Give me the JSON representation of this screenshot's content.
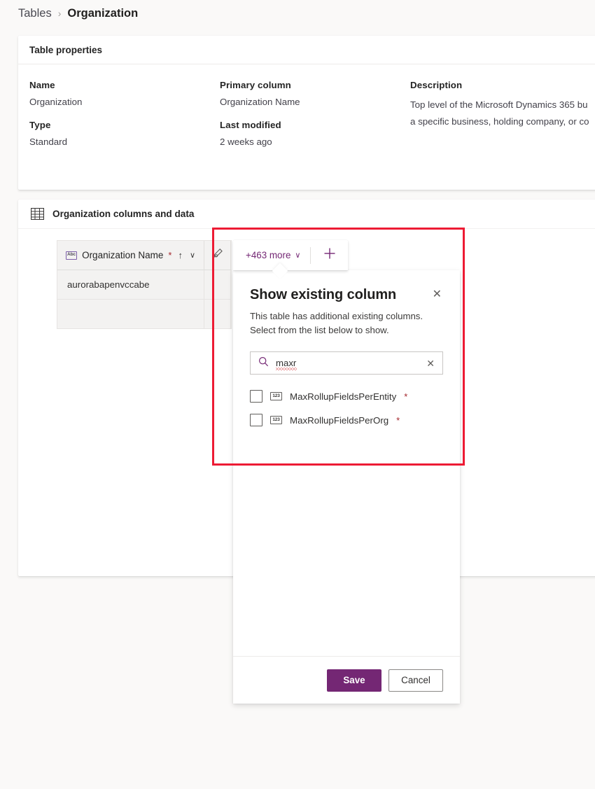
{
  "breadcrumb": {
    "root": "Tables",
    "separator": "›",
    "current": "Organization"
  },
  "properties_card": {
    "title": "Table properties",
    "fields": [
      {
        "label": "Name",
        "value": "Organization"
      },
      {
        "label": "Type",
        "value": "Standard"
      },
      {
        "label": "Primary column",
        "value": "Organization Name"
      },
      {
        "label": "Last modified",
        "value": "2 weeks ago"
      }
    ],
    "description_label": "Description",
    "description_line1": "Top level of the Microsoft Dynamics 365 bu",
    "description_line2": "a specific business, holding company, or co"
  },
  "columns_card": {
    "icon": "table-grid-icon",
    "title": "Organization columns and data",
    "grid": {
      "header": {
        "type_icon": "Abc",
        "name": "Organization Name",
        "required_marker": "*",
        "sort_indicator": "↑",
        "dropdown_chevron": "∨",
        "edit_icon": "edit-pencil-icon"
      },
      "rows": [
        {
          "organization_name": "aurorabapenvccabe"
        },
        {
          "organization_name": ""
        }
      ]
    },
    "toolbar": {
      "more_label": "+463 more",
      "more_chevron": "∨",
      "add_label": "+"
    }
  },
  "flyout": {
    "title": "Show existing column",
    "close_label": "✕",
    "subtitle": "This table has additional existing columns. Select from the list below to show.",
    "search": {
      "icon": "search-icon",
      "value": "maxr",
      "clear_label": "✕"
    },
    "columns": [
      {
        "name": "MaxRollupFieldsPerEntity",
        "required_marker": "*",
        "type_icon": "123",
        "checked": false
      },
      {
        "name": "MaxRollupFieldsPerOrg",
        "required_marker": "*",
        "type_icon": "123",
        "checked": false
      }
    ],
    "save_label": "Save",
    "cancel_label": "Cancel"
  },
  "colors": {
    "accent_purple": "#742774",
    "required_red": "#a4262c",
    "annotation_red": "#ed1b34",
    "page_background": "#faf9f8",
    "grid_header_bg": "#f3f2f1"
  }
}
